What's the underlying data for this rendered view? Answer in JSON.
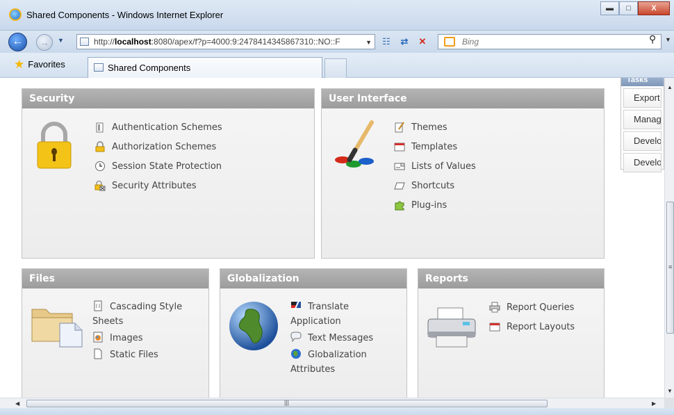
{
  "window": {
    "title": "Shared Components - Windows Internet Explorer"
  },
  "navigation": {
    "url_prefix": "http://",
    "url_host": "localhost",
    "url_rest": ":8080/apex/f?p=4000:9:2478414345867310::NO::F",
    "search_placeholder": "Bing"
  },
  "favorites": {
    "label": "Favorites"
  },
  "tabs": [
    {
      "label": "Shared Components"
    }
  ],
  "regions": {
    "security": {
      "title": "Security",
      "links": [
        "Authentication Schemes",
        "Authorization Schemes",
        "Session State Protection",
        "Security Attributes"
      ]
    },
    "user_interface": {
      "title": "User Interface",
      "links": [
        "Themes",
        "Templates",
        "Lists of Values",
        "Shortcuts",
        "Plug-ins"
      ]
    },
    "files": {
      "title": "Files",
      "links": [
        "Cascading Style Sheets",
        "Images",
        "Static Files"
      ]
    },
    "globalization": {
      "title": "Globalization",
      "links": [
        "Translate Application",
        "Text Messages",
        "Globalization Attributes"
      ]
    },
    "reports": {
      "title": "Reports",
      "links": [
        "Report Queries",
        "Report Layouts"
      ]
    }
  },
  "tasks": {
    "title": "Tasks",
    "items": [
      "Export",
      "Manag",
      "Develo",
      "Develo"
    ]
  },
  "colors": {
    "region_header": "#a6a6a6",
    "region_body": "#f0f0f0",
    "tasks_header": "#8aa2c4"
  }
}
